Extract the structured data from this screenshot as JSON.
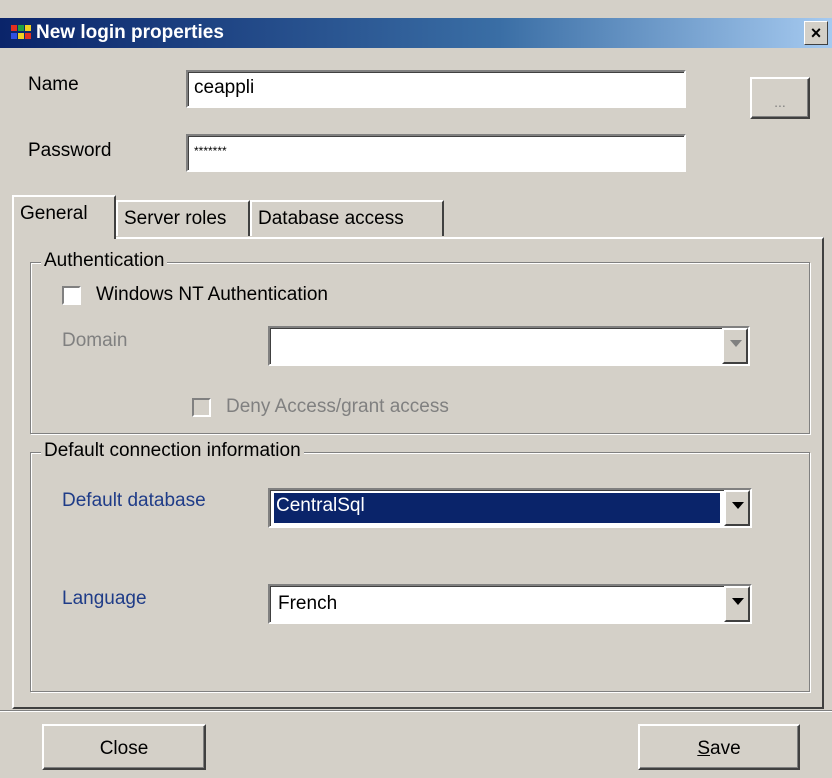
{
  "window": {
    "title": "New login properties",
    "close_glyph": "×",
    "icon": "app-icon"
  },
  "fields": {
    "name_label": "Name",
    "name_value": "ceappli",
    "browse_label": "...",
    "password_label": "Password",
    "password_value": "*******"
  },
  "tabs": [
    {
      "label": "General",
      "active": true
    },
    {
      "label": "Server roles",
      "active": false
    },
    {
      "label": "Database access",
      "active": false
    }
  ],
  "authentication": {
    "group_title": "Authentication",
    "windows_nt_label": "Windows NT Authentication",
    "windows_nt_checked": false,
    "domain_label": "Domain",
    "domain_value": "",
    "deny_label": "Deny Access/grant access",
    "deny_checked": false
  },
  "connection": {
    "group_title": "Default connection information",
    "default_db_label": "Default database",
    "default_db_value": "CentralSql",
    "language_label": "Language",
    "language_value": "French"
  },
  "buttons": {
    "close_label": "Close",
    "save_label": "Save",
    "save_mnemonic": "S",
    "save_rest": "ave"
  },
  "colors": {
    "title_gradient_start": "#0a246a",
    "title_gradient_end": "#a6caf0",
    "face": "#d4d0c8",
    "label_blue": "#1f3c88",
    "selection": "#0a246a"
  }
}
